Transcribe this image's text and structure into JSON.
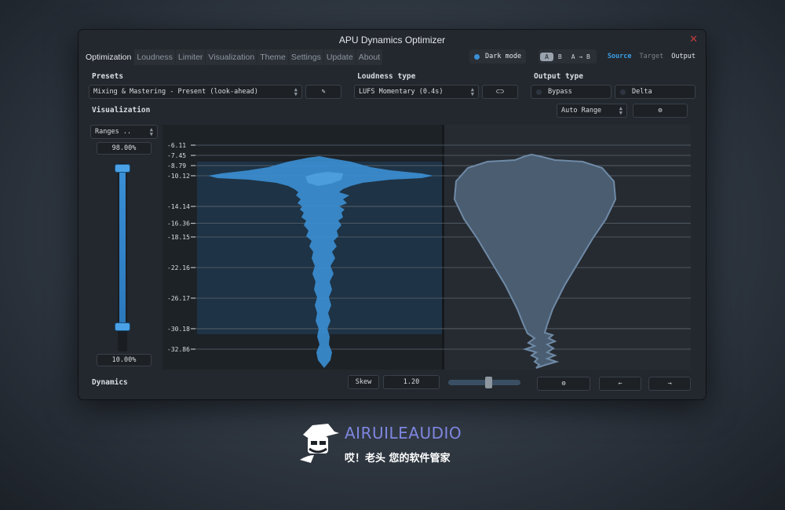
{
  "window": {
    "title": "APU Dynamics Optimizer"
  },
  "tabs": [
    "Optimization",
    "Loudness",
    "Limiter",
    "Visualization",
    "Theme",
    "Settings",
    "Update",
    "About"
  ],
  "top_controls": {
    "dark_mode_label": "Dark mode",
    "ab": [
      "A",
      "B",
      "A → B"
    ],
    "view_modes": [
      "Source",
      "Target",
      "Output"
    ]
  },
  "presets": {
    "label": "Presets",
    "selected": "Mixing & Mastering - Present (look-ahead)"
  },
  "loudness": {
    "label": "Loudness type",
    "selected": "LUFS Momentary (0.4s)"
  },
  "output_type": {
    "label": "Output type",
    "bypass": "Bypass",
    "delta": "Delta"
  },
  "visualization": {
    "label": "Visualization",
    "range_mode": "Auto Range",
    "ranges_select": "Ranges ..",
    "top_pct": "98.00%",
    "bottom_pct": "10.00%",
    "ticks": [
      "-6.11",
      "-7.45",
      "-8.79",
      "-10.12",
      "-14.14",
      "-16.36",
      "-18.15",
      "-22.16",
      "-26.17",
      "-30.18",
      "-32.86"
    ]
  },
  "dynamics": {
    "label": "Dynamics",
    "skew_label": "Skew",
    "skew_value": "1.20"
  },
  "brand": {
    "name": "AIRUILEAUDIO",
    "slogan": "哎！老头 您的软件管家"
  },
  "colors": {
    "accent": "#3a8fd6",
    "brand": "#7f86e0",
    "close": "#c13d3d"
  }
}
